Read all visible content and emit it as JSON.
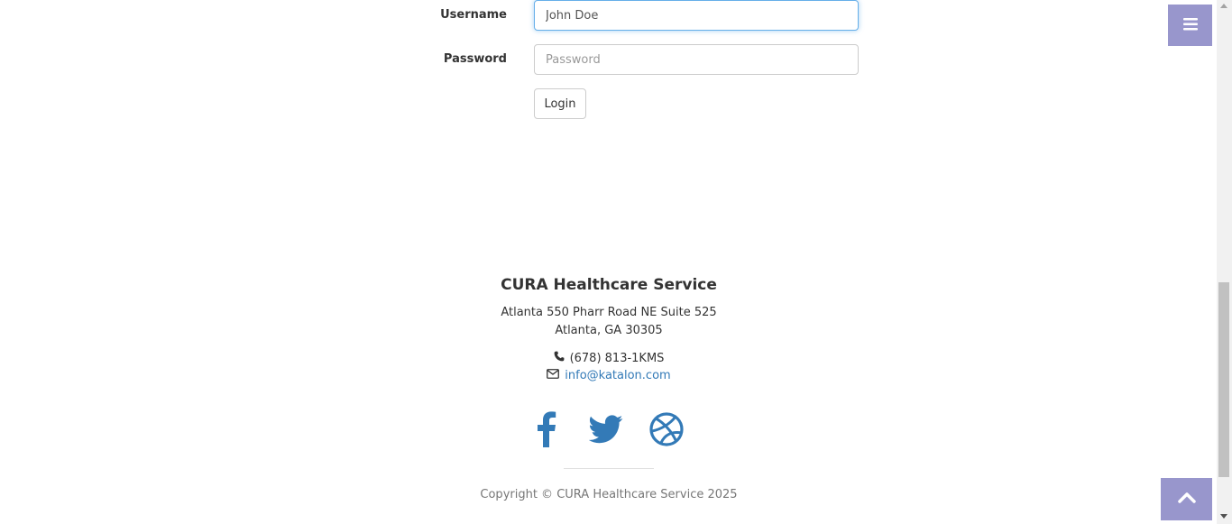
{
  "login_form": {
    "username_label": "Username",
    "username_value": "John Doe",
    "password_label": "Password",
    "password_placeholder": "Password",
    "login_button": "Login"
  },
  "footer": {
    "title": "CURA Healthcare Service",
    "address_line1": "Atlanta 550 Pharr Road NE Suite 525",
    "address_line2": "Atlanta, GA 30305",
    "phone": "(678) 813-1KMS",
    "email": "info@katalon.com",
    "social_icons": [
      "facebook-icon",
      "twitter-icon",
      "dribbble-icon"
    ],
    "copyright": "Copyright © CURA Healthcare Service 2025"
  },
  "colors": {
    "accent": "#9896cc",
    "social": "#337ab7",
    "link": "#337ab7"
  }
}
